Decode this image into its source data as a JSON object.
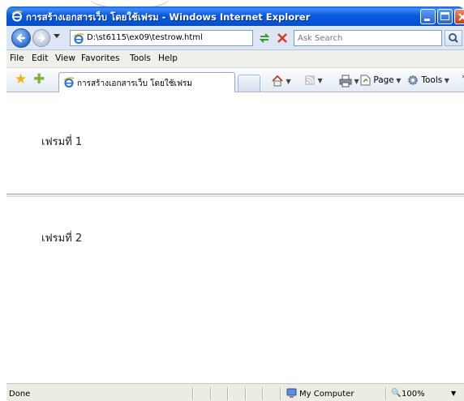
{
  "window": {
    "title": "การสร้างเอกสารเว็บ โดยใช้เฟรม - Windows Internet Explorer"
  },
  "address_bar": {
    "url": "D:\\st6115\\ex09\\testrow.html"
  },
  "search": {
    "placeholder": "Ask Search"
  },
  "menu": {
    "items": [
      "File",
      "Edit",
      "View",
      "Favorites",
      "Tools",
      "Help"
    ]
  },
  "tab": {
    "label": "การสร้างเอกสารเว็บ โดยใช้เฟรม"
  },
  "command_bar": {
    "page_label": "Page",
    "tools_label": "Tools",
    "chevron": "»"
  },
  "frames": {
    "frame1_text": "เฟรมที่ 1",
    "frame2_text": "เฟรมที่ 2"
  },
  "status_bar": {
    "status": "Done",
    "zone": "My Computer",
    "zoom": "100%"
  },
  "icons": {
    "title_ie": "ie-logo-icon",
    "back": "back-arrow-icon",
    "forward": "forward-arrow-icon",
    "refresh": "refresh-icon",
    "stop": "stop-icon",
    "search": "search-icon",
    "favorites": "favorites-star-icon",
    "add_favorites": "add-favorites-icon",
    "home": "home-icon",
    "feeds": "feeds-icon",
    "print": "print-icon",
    "zone": "my-computer-icon",
    "zoom": "zoom-icon"
  },
  "colors": {
    "titlebar": "#0a5ae0",
    "close_button": "#c4401b",
    "toolbar_bg": "#dde6f4",
    "status_bg": "#ecece4"
  }
}
